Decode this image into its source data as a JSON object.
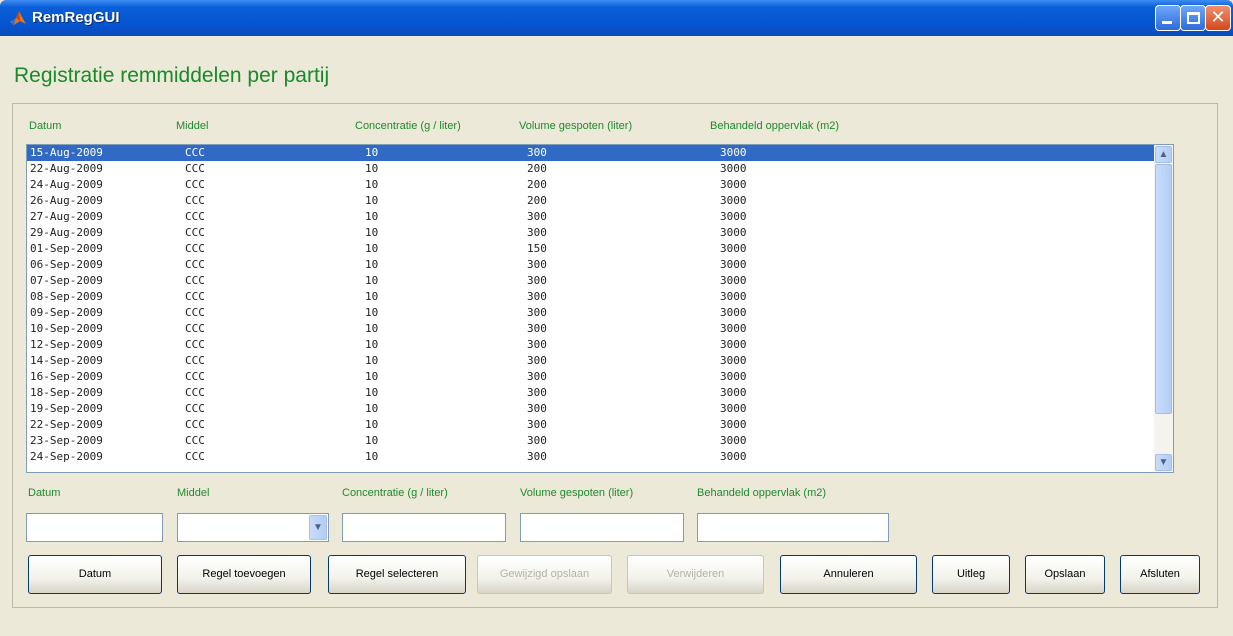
{
  "window": {
    "title": "RemRegGUI"
  },
  "heading": "Registratie remmiddelen per partij",
  "list": {
    "headers": [
      "Datum",
      "Middel",
      "Concentratie (g / liter)",
      "Volume gespoten (liter)",
      "Behandeld oppervlak (m2)"
    ],
    "selected_index": 0,
    "rows": [
      {
        "datum": "15-Aug-2009",
        "middel": "CCC",
        "conc": "10",
        "vol": "300",
        "opp": "3000"
      },
      {
        "datum": "22-Aug-2009",
        "middel": "CCC",
        "conc": "10",
        "vol": "200",
        "opp": "3000"
      },
      {
        "datum": "24-Aug-2009",
        "middel": "CCC",
        "conc": "10",
        "vol": "200",
        "opp": "3000"
      },
      {
        "datum": "26-Aug-2009",
        "middel": "CCC",
        "conc": "10",
        "vol": "200",
        "opp": "3000"
      },
      {
        "datum": "27-Aug-2009",
        "middel": "CCC",
        "conc": "10",
        "vol": "300",
        "opp": "3000"
      },
      {
        "datum": "29-Aug-2009",
        "middel": "CCC",
        "conc": "10",
        "vol": "300",
        "opp": "3000"
      },
      {
        "datum": "01-Sep-2009",
        "middel": "CCC",
        "conc": "10",
        "vol": "150",
        "opp": "3000"
      },
      {
        "datum": "06-Sep-2009",
        "middel": "CCC",
        "conc": "10",
        "vol": "300",
        "opp": "3000"
      },
      {
        "datum": "07-Sep-2009",
        "middel": "CCC",
        "conc": "10",
        "vol": "300",
        "opp": "3000"
      },
      {
        "datum": "08-Sep-2009",
        "middel": "CCC",
        "conc": "10",
        "vol": "300",
        "opp": "3000"
      },
      {
        "datum": "09-Sep-2009",
        "middel": "CCC",
        "conc": "10",
        "vol": "300",
        "opp": "3000"
      },
      {
        "datum": "10-Sep-2009",
        "middel": "CCC",
        "conc": "10",
        "vol": "300",
        "opp": "3000"
      },
      {
        "datum": "12-Sep-2009",
        "middel": "CCC",
        "conc": "10",
        "vol": "300",
        "opp": "3000"
      },
      {
        "datum": "14-Sep-2009",
        "middel": "CCC",
        "conc": "10",
        "vol": "300",
        "opp": "3000"
      },
      {
        "datum": "16-Sep-2009",
        "middel": "CCC",
        "conc": "10",
        "vol": "300",
        "opp": "3000"
      },
      {
        "datum": "18-Sep-2009",
        "middel": "CCC",
        "conc": "10",
        "vol": "300",
        "opp": "3000"
      },
      {
        "datum": "19-Sep-2009",
        "middel": "CCC",
        "conc": "10",
        "vol": "300",
        "opp": "3000"
      },
      {
        "datum": "22-Sep-2009",
        "middel": "CCC",
        "conc": "10",
        "vol": "300",
        "opp": "3000"
      },
      {
        "datum": "23-Sep-2009",
        "middel": "CCC",
        "conc": "10",
        "vol": "300",
        "opp": "3000"
      },
      {
        "datum": "24-Sep-2009",
        "middel": "CCC",
        "conc": "10",
        "vol": "300",
        "opp": "3000"
      }
    ]
  },
  "form": {
    "labels": {
      "datum": "Datum",
      "middel": "Middel",
      "conc": "Concentratie (g / liter)",
      "vol": "Volume gespoten (liter)",
      "opp": "Behandeld oppervlak (m2)"
    },
    "values": {
      "datum": "",
      "middel": "",
      "conc": "",
      "vol": "",
      "opp": ""
    }
  },
  "buttons": {
    "datum": "Datum",
    "regel_toevoegen": "Regel toevoegen",
    "regel_selecteren": "Regel selecteren",
    "gewijzigd_opslaan": "Gewijzigd opslaan",
    "verwijderen": "Verwijderen",
    "annuleren": "Annuleren",
    "uitleg": "Uitleg",
    "opslaan": "Opslaan",
    "afsluten": "Afsluten"
  },
  "colors": {
    "label_green": "#1e8a2c",
    "selection": "#316ac5",
    "titlebar": "#0554d0"
  },
  "icons": [
    "matlab-logo-icon",
    "minimize-icon",
    "maximize-icon",
    "close-icon",
    "scroll-up-icon",
    "scroll-down-icon",
    "dropdown-arrow-icon"
  ]
}
